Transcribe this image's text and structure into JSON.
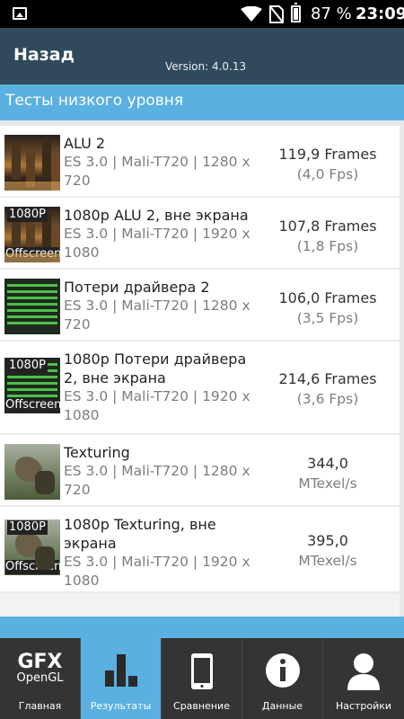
{
  "status_bar": {
    "battery_percent": "87 %",
    "time": "23:09",
    "icons": [
      "gallery-icon",
      "wifi-icon",
      "no-sim-icon",
      "battery-icon"
    ]
  },
  "header": {
    "back_label": "Назад",
    "version": "Version: 4.0.13"
  },
  "section": {
    "title": "Тесты низкого уровня"
  },
  "tests": [
    {
      "title": "ALU 2",
      "subtitle": "ES 3.0 | Mali-T720 | 1280 x 720",
      "score": "119,9 Frames",
      "score_sub": "(4,0 Fps)",
      "thumb": "alu-thumbnail",
      "badge_top": "",
      "badge_bottom": ""
    },
    {
      "title": "1080p ALU 2, вне экрана",
      "subtitle": "ES 3.0 | Mali-T720 | 1920 x 1080",
      "score": "107,8 Frames",
      "score_sub": "(1,8 Fps)",
      "thumb": "alu-offscreen-thumbnail",
      "badge_top": "1080P",
      "badge_bottom": "Offscreen"
    },
    {
      "title": "Потери драйвера 2",
      "subtitle": "ES 3.0 | Mali-T720 | 1280 x 720",
      "score": "106,0 Frames",
      "score_sub": "(3,5 Fps)",
      "thumb": "driver-thumbnail",
      "badge_top": "",
      "badge_bottom": ""
    },
    {
      "title": "1080p Потери драйвера 2, вне экрана",
      "subtitle": "ES 3.0 | Mali-T720 | 1920 x 1080",
      "score": "214,6 Frames",
      "score_sub": "(3,6 Fps)",
      "thumb": "driver-offscreen-thumbnail",
      "badge_top": "1080P",
      "badge_bottom": "Offscreen"
    },
    {
      "title": "Texturing",
      "subtitle": "ES 3.0 | Mali-T720 | 1280 x 720",
      "score": "344,0",
      "score_sub": "MTexel/s",
      "thumb": "texturing-thumbnail",
      "badge_top": "",
      "badge_bottom": ""
    },
    {
      "title": "1080p Texturing, вне экрана",
      "subtitle": "ES 3.0 | Mali-T720 | 1920 x 1080",
      "score": "395,0",
      "score_sub": "MTexel/s",
      "thumb": "texturing-offscreen-thumbnail",
      "badge_top": "1080P",
      "badge_bottom": "Offscreen"
    }
  ],
  "nav": {
    "items": [
      {
        "label": "Главная",
        "icon": "gfx-logo-icon",
        "logo_big": "GFX",
        "logo_small": "OpenGL"
      },
      {
        "label": "Результаты",
        "icon": "bar-chart-icon"
      },
      {
        "label": "Сравнение",
        "icon": "phone-icon"
      },
      {
        "label": "Данные",
        "icon": "info-icon"
      },
      {
        "label": "Настройки",
        "icon": "user-icon"
      }
    ],
    "active_index": 1
  },
  "colors": {
    "header_bg": "#2f4a5c",
    "accent": "#5ab0e0",
    "nav_bg": "#343434"
  }
}
